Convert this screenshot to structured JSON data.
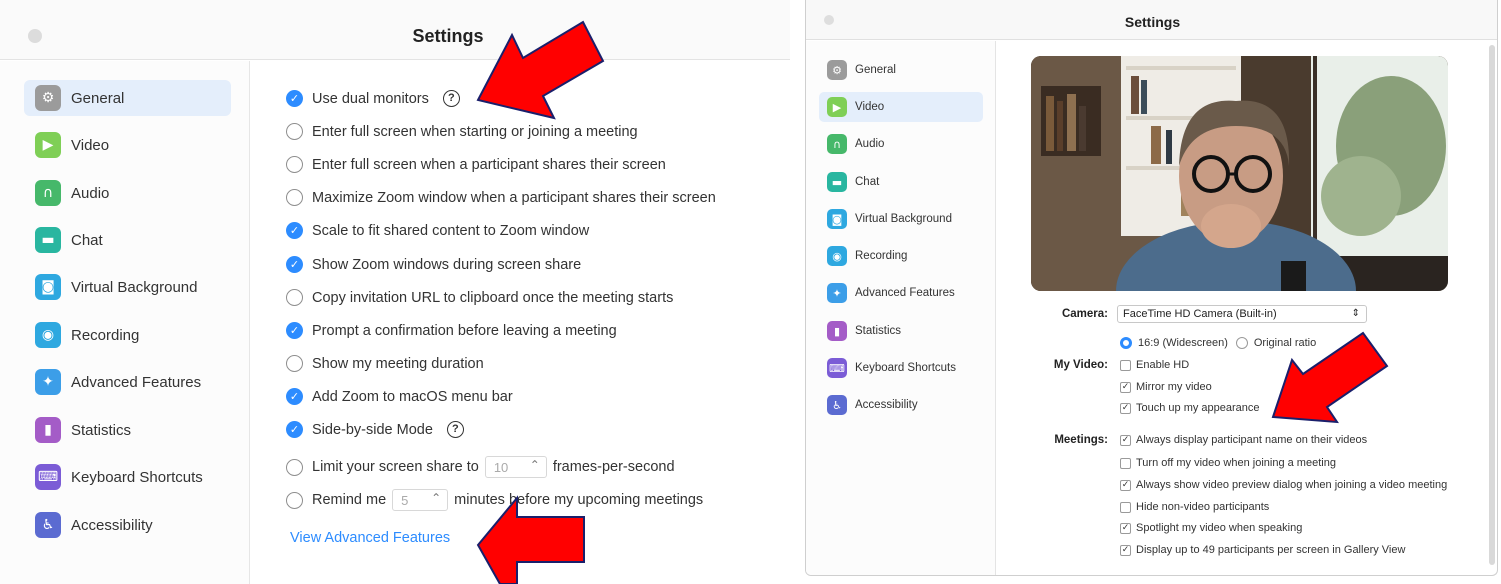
{
  "left_window": {
    "title": "Settings",
    "sidebar": [
      {
        "label": "General",
        "icon": "gear-icon",
        "color": "#9b9b9b",
        "glyph": "⚙",
        "active": true
      },
      {
        "label": "Video",
        "icon": "video-icon",
        "color": "#7fcf56",
        "glyph": "▶",
        "active": false
      },
      {
        "label": "Audio",
        "icon": "headphones-icon",
        "color": "#46b86a",
        "glyph": "∩",
        "active": false
      },
      {
        "label": "Chat",
        "icon": "chat-icon",
        "color": "#29b6a0",
        "glyph": "▬",
        "active": false
      },
      {
        "label": "Virtual Background",
        "icon": "person-frame-icon",
        "color": "#2ea8e0",
        "glyph": "◙",
        "active": false
      },
      {
        "label": "Recording",
        "icon": "record-icon",
        "color": "#2ea8e0",
        "glyph": "◉",
        "active": false
      },
      {
        "label": "Advanced Features",
        "icon": "sparkle-icon",
        "color": "#3c9ee8",
        "glyph": "✦",
        "active": false
      },
      {
        "label": "Statistics",
        "icon": "bar-chart-icon",
        "color": "#a45cc7",
        "glyph": "▮",
        "active": false
      },
      {
        "label": "Keyboard Shortcuts",
        "icon": "keyboard-icon",
        "color": "#7b5cd6",
        "glyph": "⌨",
        "active": false
      },
      {
        "label": "Accessibility",
        "icon": "accessibility-icon",
        "color": "#5b6bd1",
        "glyph": "♿",
        "active": false
      }
    ],
    "options": [
      {
        "label": "Use dual monitors",
        "checked": true,
        "help": true
      },
      {
        "label": "Enter full screen when starting or joining a meeting",
        "checked": false
      },
      {
        "label": "Enter full screen when a participant shares their screen",
        "checked": false
      },
      {
        "label": "Maximize Zoom window when a participant shares their screen",
        "checked": false
      },
      {
        "label": "Scale to fit shared content to Zoom window",
        "checked": true
      },
      {
        "label": "Show Zoom windows during screen share",
        "checked": true
      },
      {
        "label": "Copy invitation URL to clipboard once the meeting starts",
        "checked": false
      },
      {
        "label": "Prompt a confirmation before leaving a meeting",
        "checked": true
      },
      {
        "label": "Show my meeting duration",
        "checked": false
      },
      {
        "label": "Add Zoom to macOS menu bar",
        "checked": true
      },
      {
        "label": "Side-by-side Mode",
        "checked": true,
        "help": true
      }
    ],
    "limit_share": {
      "prefix": "Limit your screen share to",
      "value": "10",
      "suffix": "frames-per-second",
      "checked": false
    },
    "remind": {
      "prefix": "Remind me",
      "value": "5",
      "suffix": "minutes before my upcoming meetings",
      "checked": false
    },
    "link": "View Advanced Features"
  },
  "right_window": {
    "title": "Settings",
    "sidebar": [
      {
        "label": "General",
        "icon": "gear-icon",
        "color": "#9b9b9b",
        "glyph": "⚙",
        "active": false
      },
      {
        "label": "Video",
        "icon": "video-icon",
        "color": "#7fcf56",
        "glyph": "▶",
        "active": true
      },
      {
        "label": "Audio",
        "icon": "headphones-icon",
        "color": "#46b86a",
        "glyph": "∩",
        "active": false
      },
      {
        "label": "Chat",
        "icon": "chat-icon",
        "color": "#29b6a0",
        "glyph": "▬",
        "active": false
      },
      {
        "label": "Virtual Background",
        "icon": "person-frame-icon",
        "color": "#2ea8e0",
        "glyph": "◙",
        "active": false
      },
      {
        "label": "Recording",
        "icon": "record-icon",
        "color": "#2ea8e0",
        "glyph": "◉",
        "active": false
      },
      {
        "label": "Advanced Features",
        "icon": "sparkle-icon",
        "color": "#3c9ee8",
        "glyph": "✦",
        "active": false
      },
      {
        "label": "Statistics",
        "icon": "bar-chart-icon",
        "color": "#a45cc7",
        "glyph": "▮",
        "active": false
      },
      {
        "label": "Keyboard Shortcuts",
        "icon": "keyboard-icon",
        "color": "#7b5cd6",
        "glyph": "⌨",
        "active": false
      },
      {
        "label": "Accessibility",
        "icon": "accessibility-icon",
        "color": "#5b6bd1",
        "glyph": "♿",
        "active": false
      }
    ],
    "camera_label": "Camera:",
    "camera_value": "FaceTime HD Camera (Built-in)",
    "ratio_widescreen": "16:9 (Widescreen)",
    "ratio_original": "Original ratio",
    "my_video_label": "My Video:",
    "my_video_options": [
      {
        "label": "Enable HD",
        "checked": false
      },
      {
        "label": "Mirror my video",
        "checked": true
      },
      {
        "label": "Touch up my appearance",
        "checked": true
      }
    ],
    "meetings_label": "Meetings:",
    "meetings_options": [
      {
        "label": "Always display participant name on their videos",
        "checked": true
      },
      {
        "label": "Turn off my video when joining a meeting",
        "checked": false
      },
      {
        "label": "Always show video preview dialog when joining a video meeting",
        "checked": true
      },
      {
        "label": "Hide non-video participants",
        "checked": false
      },
      {
        "label": "Spotlight my video when speaking",
        "checked": true
      },
      {
        "label": "Display up to 49 participants per screen in Gallery View",
        "checked": true
      }
    ]
  },
  "annotation_color": "#ff0000"
}
